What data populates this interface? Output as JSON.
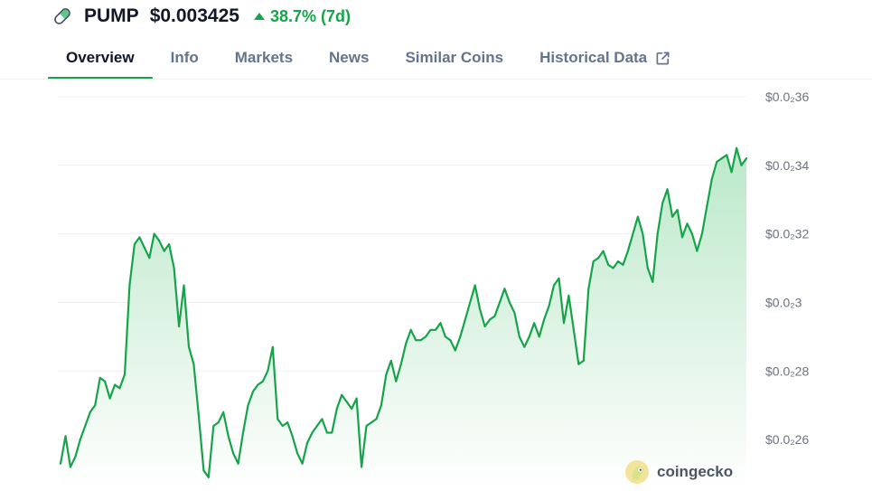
{
  "header": {
    "icon": "pill-icon",
    "symbol": "PUMP",
    "price": "$0.003425",
    "change": "38.7% (7d)",
    "change_direction": "up"
  },
  "tabs": [
    {
      "label": "Overview",
      "active": true
    },
    {
      "label": "Info",
      "active": false
    },
    {
      "label": "Markets",
      "active": false
    },
    {
      "label": "News",
      "active": false
    },
    {
      "label": "Similar Coins",
      "active": false
    },
    {
      "label": "Historical Data",
      "active": false,
      "icon": "external-link-icon"
    }
  ],
  "watermark": {
    "label": "coingecko",
    "icon": "gecko-logo-icon"
  },
  "colors": {
    "line": "#16a34a",
    "accent": "#16a34a",
    "area_top": "#bbe8c9",
    "grid": "#eef0f3"
  },
  "chart_data": {
    "type": "area",
    "yticks": [
      {
        "value": 0.0036,
        "label": "$0.0₂36"
      },
      {
        "value": 0.0034,
        "label": "$0.0₂34"
      },
      {
        "value": 0.0032,
        "label": "$0.0₂32"
      },
      {
        "value": 0.003,
        "label": "$0.0₂3"
      },
      {
        "value": 0.0028,
        "label": "$0.0₂28"
      },
      {
        "value": 0.0026,
        "label": "$0.0₂26"
      }
    ],
    "ylim": [
      0.00245,
      0.00365
    ],
    "grid": true,
    "series": [
      {
        "values": [
          0.00253,
          0.00261,
          0.00252,
          0.00255,
          0.0026,
          0.00264,
          0.00268,
          0.0027,
          0.00278,
          0.00277,
          0.00272,
          0.00276,
          0.00275,
          0.00279,
          0.00305,
          0.00317,
          0.00319,
          0.00316,
          0.00313,
          0.0032,
          0.00318,
          0.00315,
          0.00317,
          0.0031,
          0.00293,
          0.00305,
          0.00287,
          0.00282,
          0.00267,
          0.00251,
          0.00249,
          0.00264,
          0.00265,
          0.00268,
          0.00261,
          0.00256,
          0.00253,
          0.00262,
          0.0027,
          0.00274,
          0.00276,
          0.00277,
          0.0028,
          0.00287,
          0.00266,
          0.00264,
          0.00265,
          0.00261,
          0.00256,
          0.00253,
          0.00259,
          0.00262,
          0.00264,
          0.00266,
          0.00262,
          0.00262,
          0.00269,
          0.00273,
          0.00271,
          0.00269,
          0.00272,
          0.00252,
          0.00264,
          0.00265,
          0.00266,
          0.0027,
          0.00279,
          0.00283,
          0.00277,
          0.00282,
          0.00288,
          0.00292,
          0.00289,
          0.00289,
          0.0029,
          0.00292,
          0.00292,
          0.00294,
          0.0029,
          0.00289,
          0.00286,
          0.0029,
          0.00295,
          0.003,
          0.00305,
          0.00298,
          0.00293,
          0.00295,
          0.00296,
          0.003,
          0.00304,
          0.003,
          0.00297,
          0.0029,
          0.00287,
          0.0029,
          0.00294,
          0.0029,
          0.00295,
          0.00299,
          0.00305,
          0.00307,
          0.00294,
          0.00302,
          0.00292,
          0.00282,
          0.00283,
          0.00304,
          0.00312,
          0.00313,
          0.00315,
          0.00311,
          0.0031,
          0.00312,
          0.00311,
          0.00315,
          0.0032,
          0.00325,
          0.0032,
          0.0031,
          0.00306,
          0.0032,
          0.00329,
          0.00333,
          0.00325,
          0.00327,
          0.00319,
          0.00323,
          0.0032,
          0.00315,
          0.0032,
          0.00328,
          0.00336,
          0.00341,
          0.00342,
          0.00343,
          0.00338,
          0.00345,
          0.0034,
          0.00342
        ]
      }
    ]
  }
}
